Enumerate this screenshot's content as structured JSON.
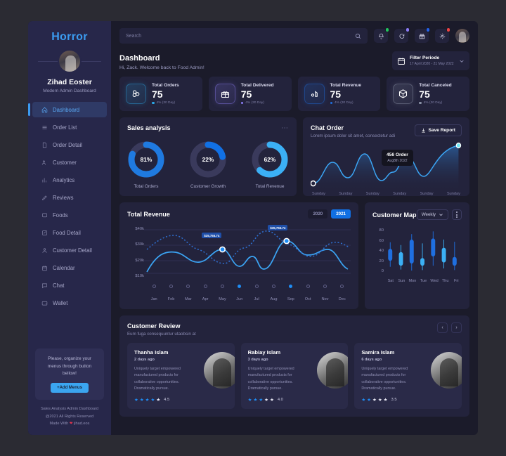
{
  "sidebar": {
    "brand": "Horror",
    "user_name": "Zihad Eoster",
    "user_role": "Modern Admin Dashboard",
    "items": [
      {
        "label": "Dashboard",
        "icon": "home-icon",
        "active": true
      },
      {
        "label": "Order List",
        "icon": "list-icon",
        "active": false
      },
      {
        "label": "Order Detail",
        "icon": "file-icon",
        "active": false
      },
      {
        "label": "Customer",
        "icon": "users-icon",
        "active": false
      },
      {
        "label": "Analytics",
        "icon": "chart-bar-icon",
        "active": false
      },
      {
        "label": "Reviews",
        "icon": "pencil-icon",
        "active": false
      },
      {
        "label": "Foods",
        "icon": "tag-icon",
        "active": false
      },
      {
        "label": "Food Detail",
        "icon": "edit-square-icon",
        "active": false
      },
      {
        "label": "Customer Detail",
        "icon": "user-icon",
        "active": false
      },
      {
        "label": "Calendar",
        "icon": "calendar-icon",
        "active": false
      },
      {
        "label": "Chat",
        "icon": "chat-icon",
        "active": false
      },
      {
        "label": "Wallet",
        "icon": "wallet-icon",
        "active": false
      }
    ],
    "promo": {
      "text": "Please, organize your menus through button bellow!",
      "button": "+Add Menus"
    },
    "footer": {
      "line1": "Sales Analysis Admin Dashboard",
      "line2": "@2021 All Rights Reserved",
      "line3_pre": "Made With",
      "line3_post": "jihad.eos"
    }
  },
  "topbar": {
    "search_placeholder": "Search",
    "icons": [
      {
        "name": "bell-icon",
        "badge_color": "#22c55e"
      },
      {
        "name": "chat-icon",
        "badge_color": "#8b7cf6"
      },
      {
        "name": "gift-icon",
        "badge_color": "#2563eb"
      },
      {
        "name": "gear-icon",
        "badge_color": "#ef4444"
      }
    ]
  },
  "page": {
    "title": "Dashboard",
    "subtitle": "Hi, Zack. Welcome back to Food Admin!",
    "filter_label": "Filter Periode",
    "filter_dates": "17 April 2020 - 21 May 2022"
  },
  "stats": [
    {
      "label": "Total Orders",
      "value": "75",
      "delta": "4% (30 Day)",
      "icon": "orders-icon",
      "accent": "#2aa8e8"
    },
    {
      "label": "Total Delivered",
      "value": "75",
      "delta": "4% (30 Day)",
      "icon": "delivery-icon",
      "accent": "#8b7cf6"
    },
    {
      "label": "Total Revenue",
      "value": "75",
      "delta": "4% (30 Day)",
      "icon": "revenue-icon",
      "accent": "#1f6fe0"
    },
    {
      "label": "Total Canceled",
      "value": "75",
      "delta": "4% (30 Day)",
      "icon": "canceled-icon",
      "accent": "#8b93a8"
    }
  ],
  "sales_analysis": {
    "title": "Sales analysis",
    "menu_icon": "dots-horizontal-icon"
  },
  "chat_order": {
    "title": "Chat Order",
    "subtitle": "Lorem ipsum dolor sit amet, consectetur adi",
    "save_label": "Save Report",
    "save_icon": "download-icon",
    "tooltip_value": "456  Order",
    "tooltip_date": "Aug8th 2022"
  },
  "total_revenue": {
    "title": "Total Revenue",
    "year_prev": "2020",
    "year_current": "2021",
    "label_1": "$35,755.74",
    "label_2": "$35,755.74"
  },
  "customer_map": {
    "title": "Customer Map",
    "period": "Weekly",
    "chevron_icon": "chevron-down-icon",
    "kebab_icon": "dots-vertical-icon"
  },
  "customer_review": {
    "title": "Customer Review",
    "subtitle": "Eum fuga consequuntur utaobsin at",
    "prev_icon": "chevron-left-icon",
    "next_icon": "chevron-right-icon",
    "reviews": [
      {
        "name": "Thanha Islam",
        "time": "2 days ago",
        "text": "Uniquely target empowered manufactured products for collaborative opportunities. Dramatically pursue.",
        "score": "4.5",
        "stars_full": 4,
        "stars_empty": 1
      },
      {
        "name": "Rabiay Islam",
        "time": "3 days ago",
        "text": "Uniquely target empowered manufactured products for collaborative opportunities. Dramatically pursue.",
        "score": "4.0",
        "stars_full": 3,
        "stars_empty": 2
      },
      {
        "name": "Samira Islam",
        "time": "6 days ago",
        "text": "Uniquely target empowered manufactured products for collaborative opportunities. Dramatically pursue.",
        "score": "3.5",
        "stars_full": 2,
        "stars_empty": 3
      }
    ]
  },
  "chart_data": [
    {
      "type": "pie",
      "title": "Sales analysis",
      "labels": [
        "Total Orders",
        "Customer Growth",
        "Total Revenue"
      ],
      "values": [
        81,
        22,
        62
      ],
      "value_labels": [
        "81%",
        "22%",
        "62%"
      ],
      "track_color": "#3a3a5c",
      "fill_colors": [
        "#1f7ae0",
        "#1170e4",
        "#3bb0f5"
      ]
    },
    {
      "type": "area",
      "title": "Chat Order",
      "x": [
        "Sunday",
        "Sunday",
        "Sunday",
        "Sunday",
        "Sunday",
        "Sunday"
      ],
      "values": [
        12,
        52,
        30,
        72,
        26,
        96
      ],
      "highlight_point": {
        "x": "Sunday",
        "value": 456,
        "date": "Aug8th 2022"
      },
      "line_color": "#3ba5f5",
      "grid": false
    },
    {
      "type": "line",
      "title": "Total Revenue",
      "categories": [
        "Jan",
        "Feb",
        "Mar",
        "Apr",
        "May",
        "Jun",
        "Jul",
        "Aug",
        "Sep",
        "Oct",
        "Nov",
        "Dec"
      ],
      "ylabel": "",
      "ytick_labels": [
        "$40k",
        "$30k",
        "$20k",
        "$10k"
      ],
      "ylim": [
        10000,
        40000
      ],
      "grid": true,
      "series": [
        {
          "name": "2021",
          "style": "solid",
          "values": [
            12000,
            22000,
            19000,
            24000,
            17000,
            22000,
            30000,
            25000,
            33000,
            28000,
            24000,
            20000
          ]
        },
        {
          "name": "2020",
          "style": "dotted",
          "values": [
            22000,
            28000,
            33000,
            30000,
            24000,
            20000,
            28000,
            37000,
            33000,
            26000,
            30000,
            28000
          ]
        }
      ],
      "highlight_points": [
        {
          "x": "Jun",
          "label": "$35,755.74"
        },
        {
          "x": "Sep",
          "label": "$35,755.74"
        }
      ]
    },
    {
      "type": "bar",
      "title": "Customer Map",
      "categories": [
        "Sat",
        "Sun",
        "Mon",
        "Tue",
        "Wed",
        "Thu",
        "Fri"
      ],
      "ytick_labels": [
        "80",
        "60",
        "40",
        "20",
        "0"
      ],
      "ylim": [
        0,
        80
      ],
      "series": [
        {
          "name": "range_low",
          "values": [
            12,
            7,
            5,
            6,
            14,
            9,
            6
          ]
        },
        {
          "name": "box_low",
          "values": [
            23,
            14,
            18,
            14,
            31,
            20,
            14
          ]
        },
        {
          "name": "box_high",
          "values": [
            45,
            39,
            62,
            28,
            64,
            47,
            30
          ]
        },
        {
          "name": "range_high",
          "values": [
            57,
            52,
            72,
            55,
            77,
            62,
            58
          ]
        }
      ],
      "colors": [
        "#1f6fe0",
        "#3bb0f5",
        "#1f6fe0",
        "#3bb0f5",
        "#1f6fe0",
        "#3bb0f5",
        "#1f6fe0"
      ]
    }
  ]
}
